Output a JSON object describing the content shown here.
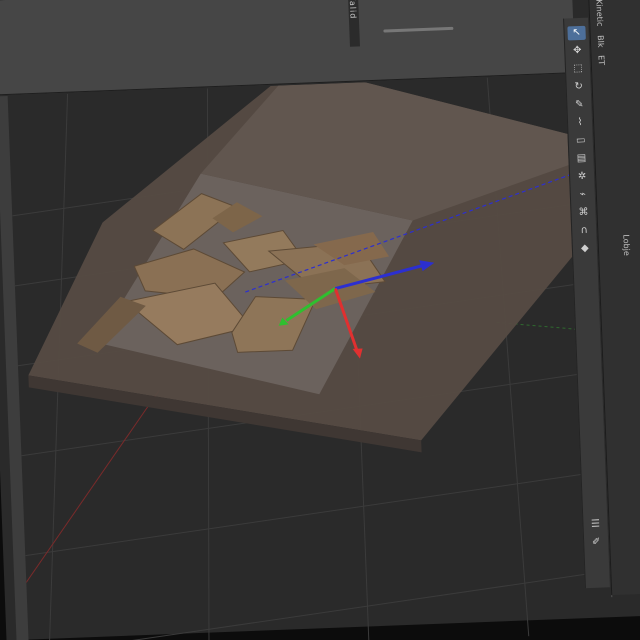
{
  "top_panel": {
    "divider_label": "Valid",
    "corner_label": "ET"
  },
  "props_tabs": [
    "Kinetic",
    "Blk",
    "ET"
  ],
  "side_tab": "Lobje",
  "toolbar": {
    "tools": [
      {
        "icon": "select-arrow-icon",
        "glyph": "↖",
        "active": true
      },
      {
        "icon": "move-icon",
        "glyph": "✥",
        "active": false
      },
      {
        "icon": "scale-icon",
        "glyph": "⬚",
        "active": false
      },
      {
        "icon": "rotate-icon",
        "glyph": "↻",
        "active": false
      },
      {
        "icon": "annotate-icon",
        "glyph": "✎",
        "active": false
      },
      {
        "icon": "measure-icon",
        "glyph": "⌇",
        "active": false
      },
      {
        "icon": "cube-icon",
        "glyph": "▭",
        "active": false
      },
      {
        "icon": "mesh-icon",
        "glyph": "▤",
        "active": false
      },
      {
        "icon": "light-icon",
        "glyph": "✲",
        "active": false
      },
      {
        "icon": "camera-icon",
        "glyph": "⌁",
        "active": false
      },
      {
        "icon": "path-icon",
        "glyph": "⌘",
        "active": false
      },
      {
        "icon": "magnet-icon",
        "glyph": "∩",
        "active": false
      },
      {
        "icon": "color-icon",
        "glyph": "◆",
        "active": false
      }
    ],
    "bottom_tools": [
      {
        "icon": "layers-icon",
        "glyph": "☰"
      },
      {
        "icon": "pen-icon",
        "glyph": "✐"
      }
    ]
  },
  "colors": {
    "x_axis": "#e03030",
    "y_axis": "#2fbf2f",
    "z_axis": "#2c2fd0",
    "platform": "#5a5048",
    "cardboard": "#8c7356",
    "viewport_bg": "#2b2b2b"
  }
}
